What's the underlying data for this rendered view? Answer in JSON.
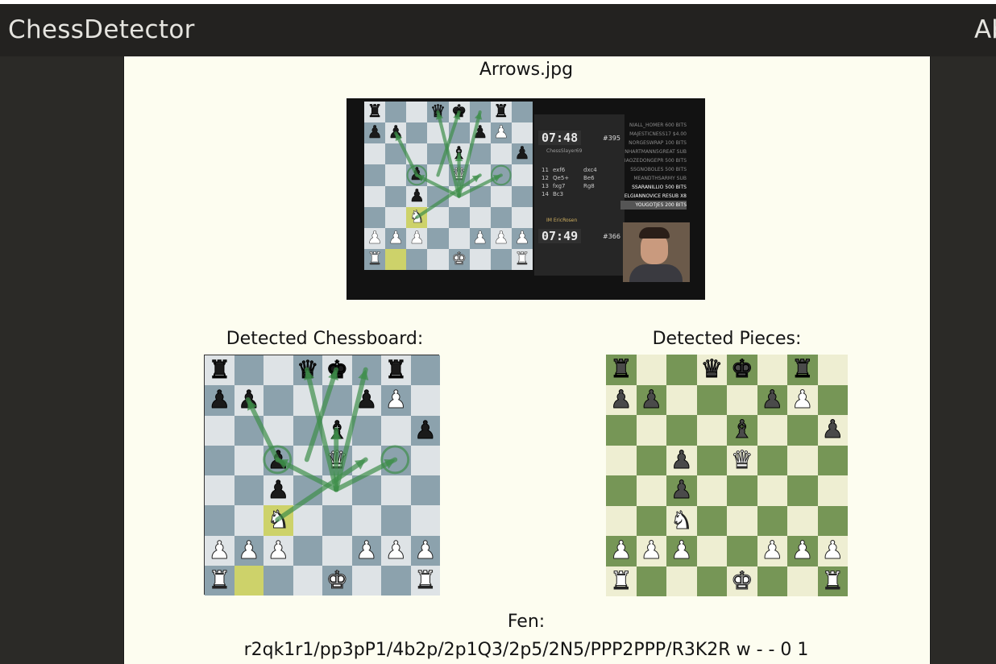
{
  "navbar": {
    "brand": "ChessDetector",
    "link_partial": "Ab"
  },
  "image_title": "Arrows.jpg",
  "stream": {
    "top_clock": "07:48",
    "top_rank": "#395",
    "top_player": "ChessSlayer69",
    "bottom_clock": "07:49",
    "bottom_rank": "#366",
    "bottom_player": "IM EricRosen",
    "moves": [
      [
        "11",
        "exf6",
        "dxc4"
      ],
      [
        "12",
        "Qe5+",
        "Be6"
      ],
      [
        "13",
        "fxg7",
        "Rg8"
      ],
      [
        "14",
        "Bc3",
        ""
      ]
    ],
    "donors": [
      "NIALL_HOMER 600 BITS",
      "MAJESTICNESS17 $4.00",
      "NORGESWRAP 100 BITS",
      "NHARTMANN5GREAT SUB",
      "IAOZEDONGEPR 500 BITS",
      "SSGNOBOLES 500 BITS",
      "MEANDTHSARMY SUB",
      "SSARANILLIO 500 BITS",
      "ELGIANNOVICE RESUB X8",
      "YOUGOTJES 200 BITS"
    ]
  },
  "chessboard_caption": "Detected Chessboard:",
  "pieces_caption": "Detected Pieces:",
  "fen_label": "Fen:",
  "fen": "r2qk1r1/pp3pP1/4b2p/2p1Q3/2p5/2N5/PPP2PPP/R3K2R w - - 0 1",
  "board_rows": [
    "r2qk1r1",
    "pp3pP1",
    "4b2p",
    "2p1Q3",
    "2p5",
    "2N5",
    "PPP2PPP",
    "R3K2R"
  ],
  "colors": {
    "bg": "#2b2a27",
    "navbar": "#232220",
    "panel": "#fdfdf0",
    "det_light": "#dee3e6",
    "det_dark": "#8ca2ad",
    "green_light": "#eeeed2",
    "green_dark": "#769656",
    "arrow": "#3e8e4a",
    "highlight": "#cdd26a"
  }
}
